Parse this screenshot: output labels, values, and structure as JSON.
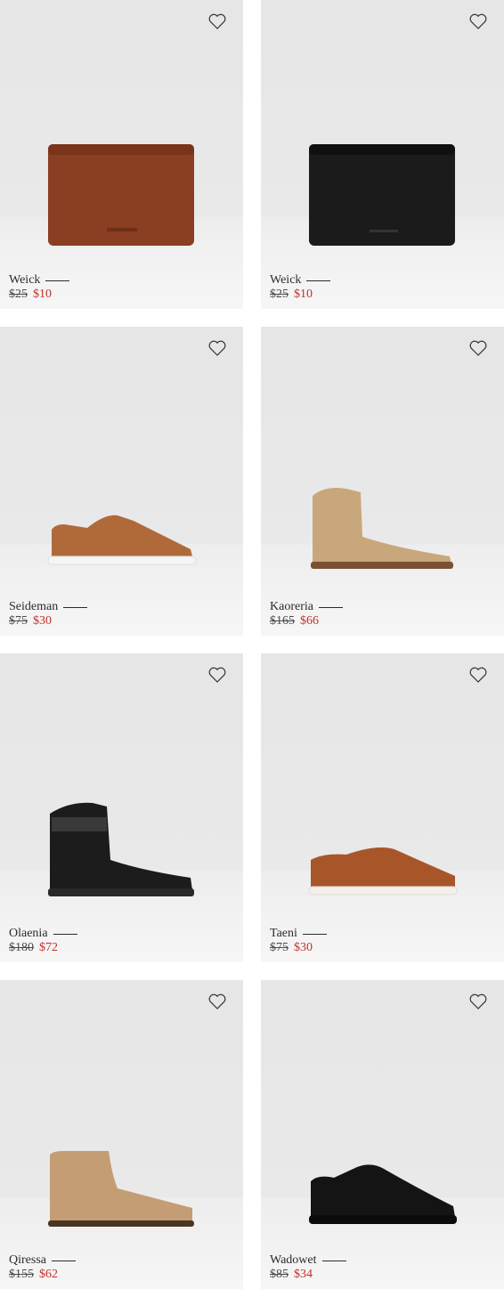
{
  "products": [
    {
      "name": "Weick",
      "old_price": "$25",
      "sale_price": "$10",
      "icon": "wallet-brown",
      "color": "#8a3e22"
    },
    {
      "name": "Weick",
      "old_price": "$25",
      "sale_price": "$10",
      "icon": "wallet-black",
      "color": "#1b1b1b"
    },
    {
      "name": "Seideman",
      "old_price": "$75",
      "sale_price": "$30",
      "icon": "sneaker-tan",
      "color": "#b06a3a"
    },
    {
      "name": "Kaoreria",
      "old_price": "$165",
      "sale_price": "$66",
      "icon": "boot-suede-beige",
      "color": "#c9a77c"
    },
    {
      "name": "Olaenia",
      "old_price": "$180",
      "sale_price": "$72",
      "icon": "boot-leather-black",
      "color": "#1c1c1c"
    },
    {
      "name": "Taeni",
      "old_price": "$75",
      "sale_price": "$30",
      "icon": "moccasin-cognac",
      "color": "#a9552a"
    },
    {
      "name": "Qiressa",
      "old_price": "$155",
      "sale_price": "$62",
      "icon": "chelsea-boot-beige",
      "color": "#c49d74"
    },
    {
      "name": "Wadowet",
      "old_price": "$85",
      "sale_price": "$34",
      "icon": "sneaker-patent-black",
      "color": "#141414"
    }
  ],
  "colors": {
    "sale": "#c3302c",
    "card_bg": "#e8e8e8"
  }
}
